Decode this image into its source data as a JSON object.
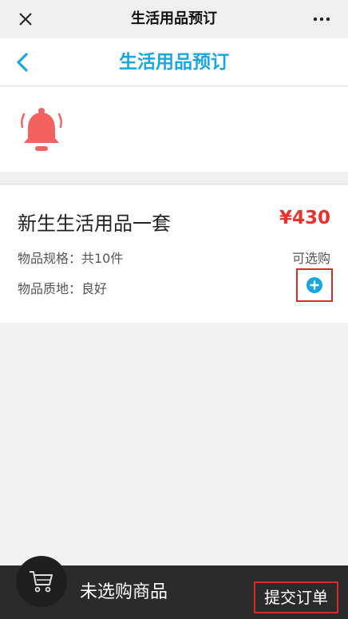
{
  "window": {
    "title": "生活用品预订",
    "close_icon": "close-icon",
    "more_icon": "more-icon"
  },
  "header": {
    "title": "生活用品预订",
    "back_icon": "back-chevron-icon"
  },
  "notice": {
    "icon": "bell-icon",
    "color": "#f4625f"
  },
  "product": {
    "name": "新生生活用品一套",
    "price": "¥430",
    "spec": "物品规格：共10件",
    "material": "物品质地：良好",
    "status": "可选购",
    "add_icon": "plus-circle-icon"
  },
  "bottom": {
    "cart_icon": "cart-icon",
    "cart_status": "未选购商品",
    "submit_label": "提交订单"
  },
  "colors": {
    "accent": "#1aa7e0",
    "price": "#e8322c",
    "highlight_border": "#d42b2b",
    "bottom_bar": "#2b2b2b"
  }
}
